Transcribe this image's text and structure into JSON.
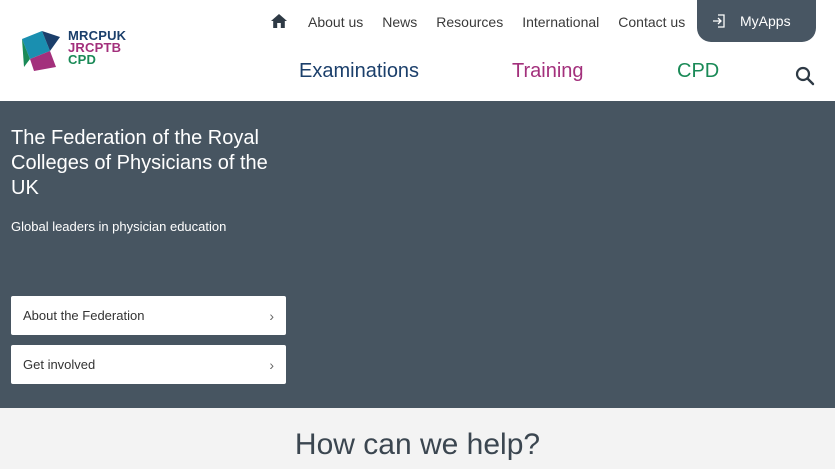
{
  "brand": {
    "lines": [
      "MRCPUK",
      "JRCPTB",
      "CPD"
    ],
    "colors": [
      "#1b3f6b",
      "#a3307c",
      "#1a8a57"
    ]
  },
  "util_nav": {
    "home_icon": "home-icon",
    "items": [
      "About us",
      "News",
      "Resources",
      "International",
      "Contact us"
    ]
  },
  "myapps": {
    "label": "MyApps",
    "icon": "sign-in-icon"
  },
  "main_nav": {
    "items": [
      {
        "label": "Examinations",
        "color": "#1b3f6b"
      },
      {
        "label": "Training",
        "color": "#a3307c"
      },
      {
        "label": "CPD",
        "color": "#1a8a57"
      }
    ],
    "search_icon": "search-icon"
  },
  "hero": {
    "title": "The Federation of the Royal Colleges of Physicians of the UK",
    "subtitle": "Global leaders in physician education",
    "buttons": [
      "About the Federation",
      "Get involved"
    ],
    "chevron": "›"
  },
  "help": {
    "title": "How can we help?"
  }
}
